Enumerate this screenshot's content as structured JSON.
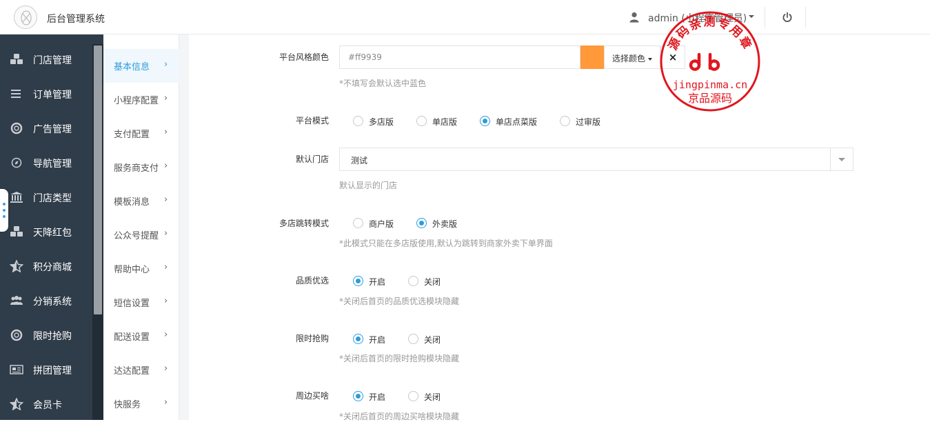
{
  "header": {
    "app_title": "后台管理系统",
    "user_label": "admin (小程序管理员)"
  },
  "sidebar": {
    "items": [
      {
        "label": "门店管理",
        "icon": "cubes-icon"
      },
      {
        "label": "订单管理",
        "icon": "list-icon"
      },
      {
        "label": "广告管理",
        "icon": "lifebuoy-icon"
      },
      {
        "label": "导航管理",
        "icon": "compass-icon"
      },
      {
        "label": "门店类型",
        "icon": "bank-icon"
      },
      {
        "label": "天降红包",
        "icon": "cubes-icon"
      },
      {
        "label": "积分商城",
        "icon": "star-half-icon"
      },
      {
        "label": "分销系统",
        "icon": "users-icon"
      },
      {
        "label": "限时抢购",
        "icon": "lifebuoy-icon"
      },
      {
        "label": "拼团管理",
        "icon": "newspaper-icon"
      },
      {
        "label": "会员卡",
        "icon": "star-half-icon"
      }
    ]
  },
  "subnav": {
    "items": [
      {
        "label": "基本信息",
        "active": true
      },
      {
        "label": "小程序配置"
      },
      {
        "label": "支付配置"
      },
      {
        "label": "服务商支付"
      },
      {
        "label": "模板消息"
      },
      {
        "label": "公众号提醒"
      },
      {
        "label": "帮助中心"
      },
      {
        "label": "短信设置"
      },
      {
        "label": "配送设置"
      },
      {
        "label": "达达配置"
      },
      {
        "label": "快服务"
      }
    ],
    "chevron": "›"
  },
  "form": {
    "theme_color": {
      "label": "平台风格颜色",
      "value": "#ff9939",
      "pick_label": "选择颜色",
      "clear_label": "×",
      "hint": "*不填写会默认选中蓝色"
    },
    "platform_mode": {
      "label": "平台模式",
      "options": [
        "多店版",
        "单店版",
        "单店点菜版",
        "过审版"
      ],
      "selected": "单店点菜版"
    },
    "default_store": {
      "label": "默认门店",
      "value": "测试",
      "hint": "默认显示的门店"
    },
    "jump_mode": {
      "label": "多店跳转模式",
      "options": [
        "商户版",
        "外卖版"
      ],
      "selected": "外卖版",
      "hint": "*此模式只能在多店版使用,默认为跳转到商家外卖下单界面"
    },
    "quality": {
      "label": "品质优选",
      "options": [
        "开启",
        "关闭"
      ],
      "selected": "开启",
      "hint": "*关闭后首页的品质优选模块隐藏"
    },
    "flash_sale": {
      "label": "限时抢购",
      "options": [
        "开启",
        "关闭"
      ],
      "selected": "开启",
      "hint": "*关闭后首页的限时抢购模块隐藏"
    },
    "nearby": {
      "label": "周边买啥",
      "options": [
        "开启",
        "关闭"
      ],
      "selected": "开启",
      "hint": "*关闭后首页的周边买啥模块隐藏"
    }
  },
  "stamp": {
    "arc_text": "源码亲测专用章",
    "site": "jingpinma.cn",
    "name": "京品源码"
  },
  "colors": {
    "sidebar_bg": "#2f3c49",
    "accent": "#2d9cdb",
    "swatch": "#ff9939",
    "stamp": "#e0161e"
  }
}
